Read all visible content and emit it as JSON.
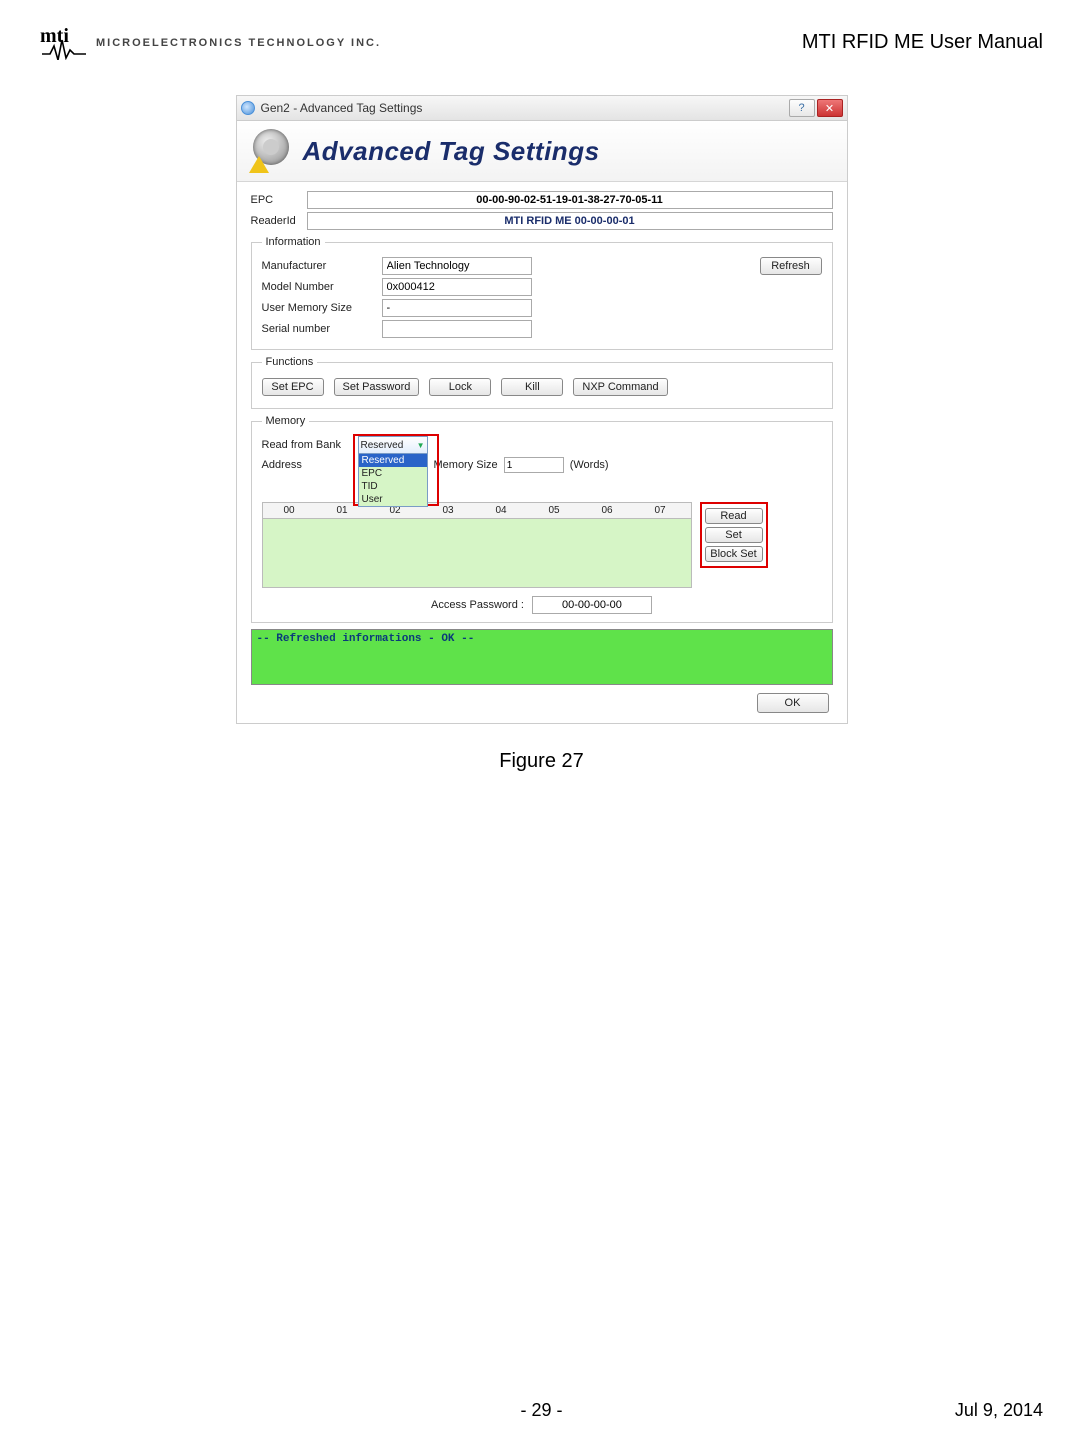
{
  "header": {
    "company_text": "MICROELECTRONICS TECHNOLOGY INC.",
    "doc_title": "MTI RFID ME User Manual"
  },
  "window": {
    "title": "Gen2 - Advanced Tag Settings",
    "help_symbol": "?",
    "close_symbol": "✕",
    "banner_title": "Advanced Tag Settings"
  },
  "epc": {
    "label": "EPC",
    "value": "00-00-90-02-51-19-01-38-27-70-05-11"
  },
  "reader": {
    "label": "ReaderId",
    "value": "MTI RFID ME 00-00-00-01"
  },
  "information": {
    "legend": "Information",
    "manufacturer_label": "Manufacturer",
    "manufacturer_value": "Alien Technology",
    "model_label": "Model Number",
    "model_value": "0x000412",
    "umem_label": "User Memory Size",
    "umem_value": "-",
    "serial_label": "Serial number",
    "serial_value": "",
    "refresh_label": "Refresh"
  },
  "functions": {
    "legend": "Functions",
    "set_epc": "Set EPC",
    "set_password": "Set Password",
    "lock": "Lock",
    "kill": "Kill",
    "nxp": "NXP Command"
  },
  "memory": {
    "legend": "Memory",
    "read_from_bank_label": "Read from Bank",
    "dropdown_selected": "Reserved",
    "dropdown_options": [
      "Reserved",
      "EPC",
      "TID",
      "User"
    ],
    "address_label": "Address",
    "memory_size_label": "Memory Size",
    "memory_size_value": "1",
    "words_label": "(Words)",
    "hex_cols": [
      "00",
      "01",
      "02",
      "03",
      "04",
      "05",
      "06",
      "07"
    ],
    "read_btn": "Read",
    "set_btn": "Set",
    "block_set_btn": "Block Set",
    "access_pw_label": "Access Password :",
    "access_pw_value": "00-00-00-00"
  },
  "status_text": "-- Refreshed informations - OK --",
  "ok_label": "OK",
  "figure_caption": "Figure 27",
  "footer": {
    "page": "- 29 -",
    "date": "Jul 9, 2014"
  }
}
